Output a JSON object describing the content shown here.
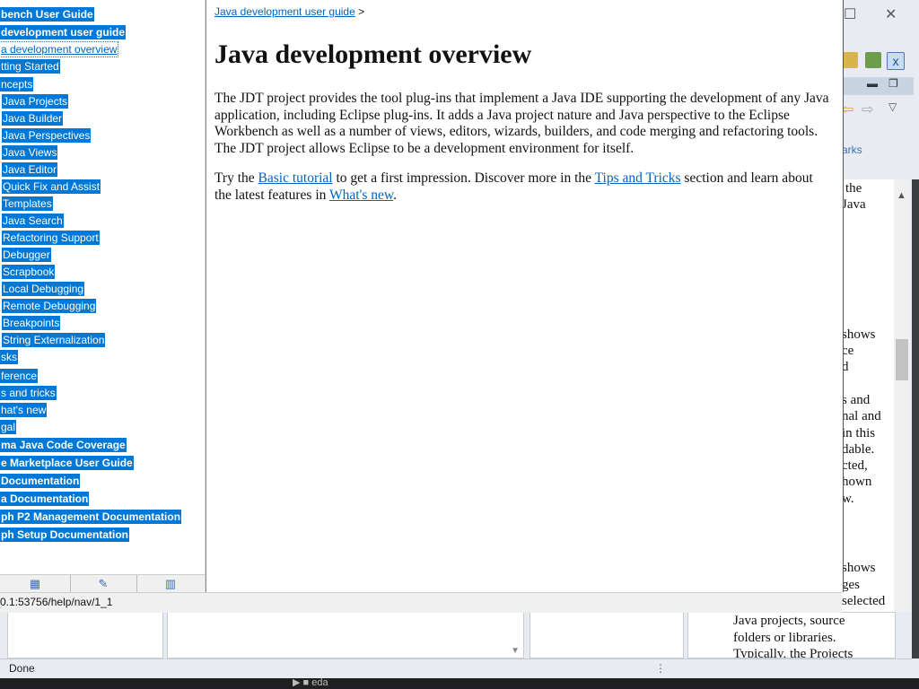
{
  "eclipse": {
    "status_text": "Done",
    "status_grip": "⋮",
    "taskbar_text": "▶ ■ eda",
    "right_text_fragments": [
      "the",
      "Java",
      "shows",
      "ce",
      "d",
      "s and",
      "nal and",
      "in this",
      "dable.",
      "cted,",
      "hown",
      "w.",
      "shows",
      "ges",
      "selected"
    ],
    "bottom_fragments": [
      "Java projects, source",
      "folders or libraries.",
      "Typically, the Projects"
    ],
    "side_link": "arks",
    "window_controls": {
      "maximize": "☐",
      "close": "✕"
    }
  },
  "help": {
    "toc": [
      {
        "label": "bench User Guide",
        "bold": true
      },
      {
        "label": "development user guide",
        "bold": true
      },
      {
        "label": "a development overview",
        "current": true
      },
      {
        "label": "tting Started"
      },
      {
        "label": "ncepts"
      },
      {
        "label": "Java Projects"
      },
      {
        "label": "Java Builder"
      },
      {
        "label": "Java Perspectives"
      },
      {
        "label": "Java Views"
      },
      {
        "label": "Java Editor"
      },
      {
        "label": "Quick Fix and Assist"
      },
      {
        "label": "Templates"
      },
      {
        "label": "Java Search"
      },
      {
        "label": "Refactoring Support"
      },
      {
        "label": "Debugger"
      },
      {
        "label": "Scrapbook"
      },
      {
        "label": "Local Debugging"
      },
      {
        "label": "Remote Debugging"
      },
      {
        "label": "Breakpoints"
      },
      {
        "label": "String Externalization"
      },
      {
        "label": "sks"
      },
      {
        "label": "ference"
      },
      {
        "label": "s and tricks"
      },
      {
        "label": "hat's new"
      },
      {
        "label": "gal"
      },
      {
        "label": "ma Java Code Coverage",
        "bold": true
      },
      {
        "label": "e Marketplace User Guide",
        "bold": true
      },
      {
        "label": "Documentation",
        "bold": true
      },
      {
        "label": "a Documentation",
        "bold": true
      },
      {
        "label": "ph P2 Management Documentation",
        "bold": true
      },
      {
        "label": "ph Setup Documentation",
        "bold": true
      }
    ],
    "url": "0.1:53756/help/nav/1_1",
    "nav_tab_icons": [
      "contents-icon",
      "search-results-icon",
      "bookmarks-icon"
    ]
  },
  "content": {
    "breadcrumb_link": "Java development user guide",
    "breadcrumb_sep": " >",
    "title": "Java development overview",
    "para1": "The JDT project provides the tool plug-ins that implement a Java IDE supporting the development of any Java application, including Eclipse plug-ins. It adds a Java project nature and Java perspective to the Eclipse Workbench as well as a number of views, editors, wizards, builders, and code merging and refactoring tools. The JDT project allows Eclipse to be a development environment for itself.",
    "para2_a": "Try the ",
    "para2_link1": "Basic tutorial",
    "para2_b": " to get a first impression. Discover more in the ",
    "para2_link2": "Tips and Tricks",
    "para2_c": " section and learn about the latest features in ",
    "para2_link3": "What's new",
    "para2_d": "."
  }
}
